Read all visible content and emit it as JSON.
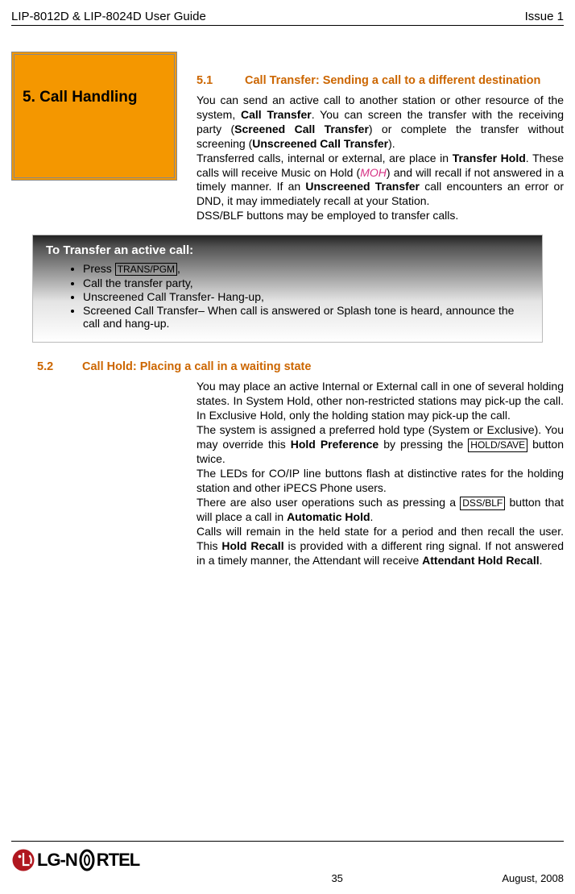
{
  "header": {
    "left": "LIP-8012D & LIP-8024D User Guide",
    "right": "Issue 1"
  },
  "sectionBox": {
    "title": "5. Call Handling"
  },
  "heading51": {
    "num": "5.1",
    "title": "Call Transfer: Sending a call to a different destination"
  },
  "para51a": {
    "p1": "You can send an active call to another station or other resource of the system, ",
    "b1": "Call Transfer",
    "p2": ".  You can screen the transfer with the receiving party (",
    "b2": "Screened Call Transfer",
    "p3": ") or complete the transfer without screening (",
    "b3": "Unscreened Call Transfer",
    "p4": ")."
  },
  "para51b": {
    "p1": "Transferred calls, internal or external, are place in ",
    "b1": "Transfer Hold",
    "p2": ". These calls will receive Music on Hold (",
    "moh": "MOH",
    "p3": ") and will recall if not answered in a timely manner. If an ",
    "b2": "Unscreened Transfer",
    "p4": " call encounters an error or DND, it may immediately recall at your Station."
  },
  "para51c": "DSS/BLF buttons may be employed to transfer calls.",
  "callout": {
    "title": "To Transfer an active call:",
    "items": {
      "i1a": "Press ",
      "key1": "TRANS/PGM",
      "i1b": ",",
      "i2": "Call the transfer party,",
      "i3": "Unscreened Call Transfer- Hang-up,",
      "i4": "Screened Call Transfer– When call is answered or Splash tone is heard, announce the call and hang-up."
    }
  },
  "heading52": {
    "num": "5.2",
    "title": "Call Hold: Placing a call in a waiting state"
  },
  "para52a": "You may place an active Internal or External call in one of several holding states.  In System Hold, other non-restricted stations may pick-up the call.  In Exclusive Hold, only the holding station may pick-up the call.",
  "para52b": {
    "p1": "The system is assigned a preferred hold type (System or Exclusive).  You may override this ",
    "b1": "Hold Preference",
    "p2": " by pressing the ",
    "key1": "HOLD/SAVE",
    "p3": " button twice."
  },
  "para52c": "The LEDs for CO/IP line buttons flash at distinctive rates for the holding station and other iPECS Phone users.",
  "para52d": {
    "p1": "There are also user operations such as pressing a ",
    "key1": "DSS/BLF",
    "p2": " button that will place a call in ",
    "b1": "Automatic Hold",
    "p3": "."
  },
  "para52e": {
    "p1": "Calls will remain in the held state for a period and then recall the user.  This ",
    "b1": "Hold Recall",
    "p2": " is provided with a different ring signal.  If not answered in a timely manner, the Attendant will receive ",
    "b2": "Attendant Hold Recall",
    "p3": "."
  },
  "footer": {
    "page": "35",
    "date": "August, 2008",
    "logoText": "LG-N",
    "logoText2": "RTEL"
  }
}
